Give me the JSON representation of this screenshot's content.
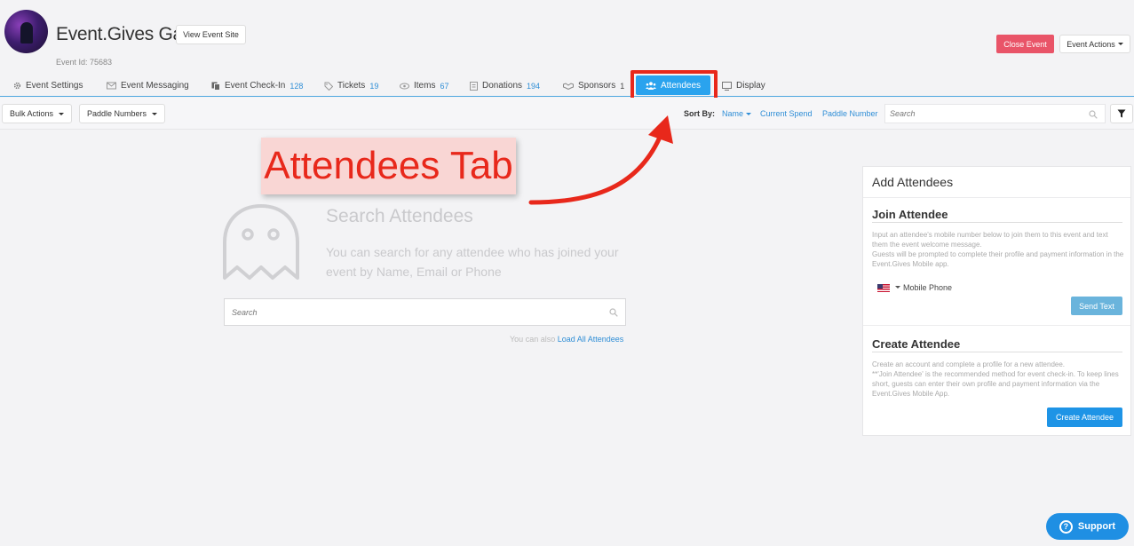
{
  "header": {
    "event_title": "Event.Gives Gala",
    "event_id": "Event Id: 75683",
    "view_site_label": "View Event Site",
    "close_event_label": "Close Event",
    "event_actions_label": "Event Actions"
  },
  "tabs": [
    {
      "label": "Event Settings",
      "icon": "gear-icon",
      "count": ""
    },
    {
      "label": "Event Messaging",
      "icon": "envelope-icon",
      "count": ""
    },
    {
      "label": "Event Check-In",
      "icon": "copy-icon",
      "count": "128"
    },
    {
      "label": "Tickets",
      "icon": "tag-icon",
      "count": "19"
    },
    {
      "label": "Items",
      "icon": "eye-icon",
      "count": "67"
    },
    {
      "label": "Donations",
      "icon": "document-icon",
      "count": "194"
    },
    {
      "label": "Sponsors",
      "icon": "handshake-icon",
      "count": "1"
    },
    {
      "label": "Attendees",
      "icon": "users-icon",
      "count": "",
      "active": true
    },
    {
      "label": "Display",
      "icon": "monitor-icon",
      "count": ""
    }
  ],
  "toolbar": {
    "bulk_actions_label": "Bulk Actions",
    "paddle_numbers_label": "Paddle Numbers",
    "sort_by_label": "Sort By:",
    "sort_options": [
      "Name",
      "Current Spend",
      "Paddle Number"
    ],
    "search_placeholder": "Search"
  },
  "annotation": {
    "text": "Attendees Tab",
    "color": "#e8281b"
  },
  "empty_state": {
    "title": "Search Attendees",
    "description": "You can search for any attendee who has joined your event by Name, Email or Phone",
    "search_placeholder": "Search",
    "load_prefix": "You can also",
    "load_link": "Load All Attendees"
  },
  "add_panel": {
    "title": "Add Attendees",
    "join": {
      "title": "Join Attendee",
      "text1": "Input an attendee's mobile number below to join them to this event and text them the event welcome message.",
      "text2": "Guests will be prompted to complete their profile and payment information in the Event.Gives Mobile app.",
      "phone_label": "Mobile Phone",
      "send_label": "Send Text"
    },
    "create": {
      "title": "Create Attendee",
      "text1": "Create an account and complete a profile for a new attendee.",
      "text2": "**'Join Attendee' is the recommended method for event check-in. To keep lines short, guests can enter their own profile and payment information via the Event.Gives Mobile App.",
      "button_label": "Create Attendee"
    }
  },
  "support": {
    "label": "Support"
  },
  "colors": {
    "accent": "#2aa3ee",
    "danger": "#e95468",
    "link": "#2f8ed6"
  }
}
